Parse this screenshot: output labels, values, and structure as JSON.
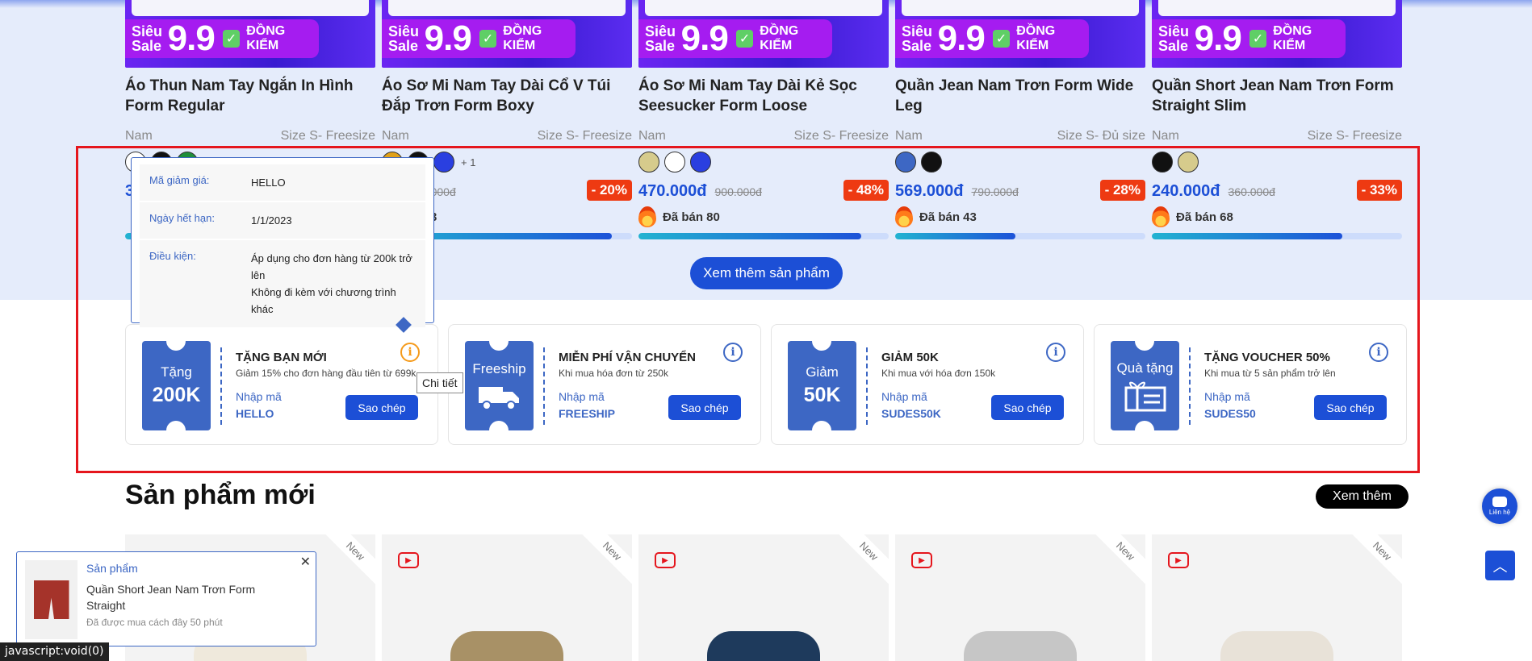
{
  "banner": {
    "sieu_sale": "Siêu Sale",
    "nine": "9.9",
    "dong_kiem": "ĐỒNG KIỂM"
  },
  "products": [
    {
      "name": "Áo Thun Nam Tay Ngắn In Hình Form Regular",
      "gender": "Nam",
      "size": "Size S- Freesize",
      "swatches": [
        "#ffffff",
        "#111111",
        "#1f8f3a"
      ],
      "more": "",
      "price": "3",
      "old_price": "",
      "discount": "",
      "sold": "",
      "progress": 0.6
    },
    {
      "name": "Áo Sơ Mi Nam Tay Dài Cổ V Túi Đắp Trơn Form Boxy",
      "gender": "Nam",
      "size": "Size S- Freesize",
      "swatches": [
        "#e0a11a",
        "#111111",
        "#2a3fe0"
      ],
      "more": "+ 1",
      "price": "0đ",
      "old_price": "690.000đ",
      "discount": "- 20%",
      "sold": "án 83",
      "progress": 0.92
    },
    {
      "name": "Áo Sơ Mi Nam Tay Dài Kẻ Sọc Seesucker Form Loose",
      "gender": "Nam",
      "size": "Size S- Freesize",
      "swatches": [
        "#d6cb8c",
        "#ffffff",
        "#2a3fe0"
      ],
      "more": "",
      "price": "470.000đ",
      "old_price": "900.000đ",
      "discount": "- 48%",
      "sold": "Đã bán 80",
      "progress": 0.89
    },
    {
      "name": "Quần Jean Nam Trơn Form Wide Leg",
      "gender": "Nam",
      "size": "Size S- Đủ size",
      "swatches": [
        "#3d67c4",
        "#111111"
      ],
      "more": "",
      "price": "569.000đ",
      "old_price": "790.000đ",
      "discount": "- 28%",
      "sold": "Đã bán 43",
      "progress": 0.48
    },
    {
      "name": "Quần Short Jean Nam Trơn Form Straight Slim",
      "gender": "Nam",
      "size": "Size S- Freesize",
      "swatches": [
        "#111111",
        "#d6cb8c"
      ],
      "more": "",
      "price": "240.000đ",
      "old_price": "360.000đ",
      "discount": "- 33%",
      "sold": "Đã bán 68",
      "progress": 0.76
    }
  ],
  "see_more_products": "Xem thêm sản phẩm",
  "coupons": [
    {
      "ticket_top": "Tặng",
      "ticket_big": "200K",
      "title": "TẶNG BẠN MỚI",
      "desc": "Giảm 15% cho đơn hàng đầu tiên từ 699k",
      "label": "Nhập mã",
      "code": "HELLO",
      "copy": "Sao chép"
    },
    {
      "ticket_top": "Freeship",
      "ticket_big": "",
      "title": "MIỄN PHÍ VẬN CHUYỂN",
      "desc": "Khi mua hóa đơn từ 250k",
      "label": "Nhập mã",
      "code": "FREESHIP",
      "copy": "Sao chép"
    },
    {
      "ticket_top": "Giảm",
      "ticket_big": "50K",
      "title": "GIẢM 50K",
      "desc": "Khi mua với hóa đơn 150k",
      "label": "Nhập mã",
      "code": "SUDES50K",
      "copy": "Sao chép"
    },
    {
      "ticket_top": "Quà tặng",
      "ticket_big": "",
      "title": "TẶNG VOUCHER 50%",
      "desc": "Khi mua từ 5 sản phẩm trở lên",
      "label": "Nhập mã",
      "code": "SUDES50",
      "copy": "Sao chép"
    }
  ],
  "tooltip": {
    "code_label": "Mã giảm giá:",
    "code_value": "HELLO",
    "expiry_label": "Ngày hết hạn:",
    "expiry_value": "1/1/2023",
    "cond_label": "Điều kiện:",
    "cond_line1": "Áp dụng cho đơn hàng từ 200k trở lên",
    "cond_line2": "Không đi kèm với chương trình khác"
  },
  "chi_tiet": "Chi tiết",
  "new_section": {
    "title": "Sản phẩm mới",
    "view_more": "Xem thêm",
    "ribbon": "New",
    "shirt_colors": [
      "#efe9dc",
      "#a89166",
      "#1e3a5c",
      "#c6c6c6",
      "#e8e2d8"
    ]
  },
  "notification": {
    "category": "Sản phẩm",
    "name": "Quần Short Jean Nam Trơn Form Straight",
    "time": "Đã được mua cách đây 50 phút",
    "close": "✕"
  },
  "status_bar": "javascript:void(0)",
  "chat_label": "Liên hệ",
  "back_to_top": "︿"
}
